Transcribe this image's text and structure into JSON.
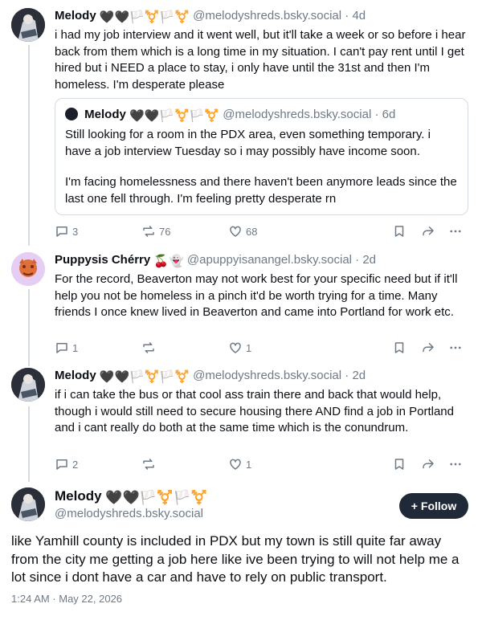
{
  "posts": [
    {
      "name": "Melody",
      "badges": "🖤🖤🏳️⚧️🏳️⚧️",
      "handle": "@melodyshreds.bsky.social",
      "time": "4d",
      "text": "i had my job interview and it went well, but it'll take a week or so before i hear back from them which is a long time in my situation. I can't pay rent until I get hired but i NEED a place to stay, i only have until the 31st and then I'm homeless. I'm desperate please",
      "quote": {
        "name": "Melody",
        "badges": "🖤🖤🏳️⚧️🏳️⚧️",
        "handle": "@melodyshreds.bsky.social",
        "time": "6d",
        "text1": "Still looking for a room in the PDX area, even something temporary. i have a job interview Tuesday so i may possibly have income soon.",
        "text2": "I'm facing homelessness and there haven't been anymore leads since the last one fell through. I'm feeling pretty desperate rn"
      },
      "replies": "3",
      "reposts": "76",
      "likes": "68"
    },
    {
      "name": "Puppysis Chérry",
      "badges": "🍒👻",
      "handle": "@apuppyisanangel.bsky.social",
      "time": "2d",
      "text": "For the record, Beaverton may not work best for your specific need but if it'll help you not be homeless in a pinch it'd be worth trying for a time. Many friends I once knew lived in Beaverton and came into Portland for work etc.",
      "replies": "1",
      "reposts": "",
      "likes": "1"
    },
    {
      "name": "Melody",
      "badges": "🖤🖤🏳️⚧️🏳️⚧️",
      "handle": "@melodyshreds.bsky.social",
      "time": "2d",
      "text": "if i can take the bus or that cool ass train there and back that would help, though i would still need to secure housing there AND find a job in Portland and i cant really do both at the same time which is the conundrum.",
      "replies": "2",
      "reposts": "",
      "likes": "1"
    }
  ],
  "main": {
    "name": "Melody",
    "badges": "🖤🖤🏳️⚧️🏳️⚧️",
    "handle": "@melodyshreds.bsky.social",
    "follow_label": "Follow",
    "text": "like Yamhill county is included in PDX but my town is still quite far away from the city me getting a job here like ive been trying to will not help me a lot since i dont have a car and have to rely on public transport.",
    "timestamp": "1:24 AM · May 22, 2026"
  },
  "separator": "·",
  "colors": {
    "muted": "#6f7a87",
    "border": "#d4dbe2",
    "button": "#1f2937"
  },
  "icons": [
    "reply-icon",
    "repost-icon",
    "like-icon",
    "bookmark-icon",
    "share-icon",
    "more-icon",
    "plus-icon"
  ]
}
